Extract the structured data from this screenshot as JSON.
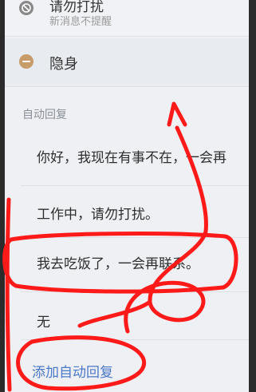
{
  "do_not_disturb": {
    "title": "请勿打扰",
    "subtitle": "新消息不提醒",
    "icon": "block-icon"
  },
  "invisible": {
    "label": "隐身",
    "icon": "minus-circle-icon"
  },
  "auto_reply": {
    "section_title": "自动回复",
    "items": [
      "你好，我现在有事不在，一会再",
      "工作中，请勿打扰。",
      "我去吃饭了，一会再联系。",
      "无"
    ],
    "add_label": "添加自动回复"
  },
  "colors": {
    "annotation": "#ff1a1a",
    "link": "#4b78c8"
  }
}
